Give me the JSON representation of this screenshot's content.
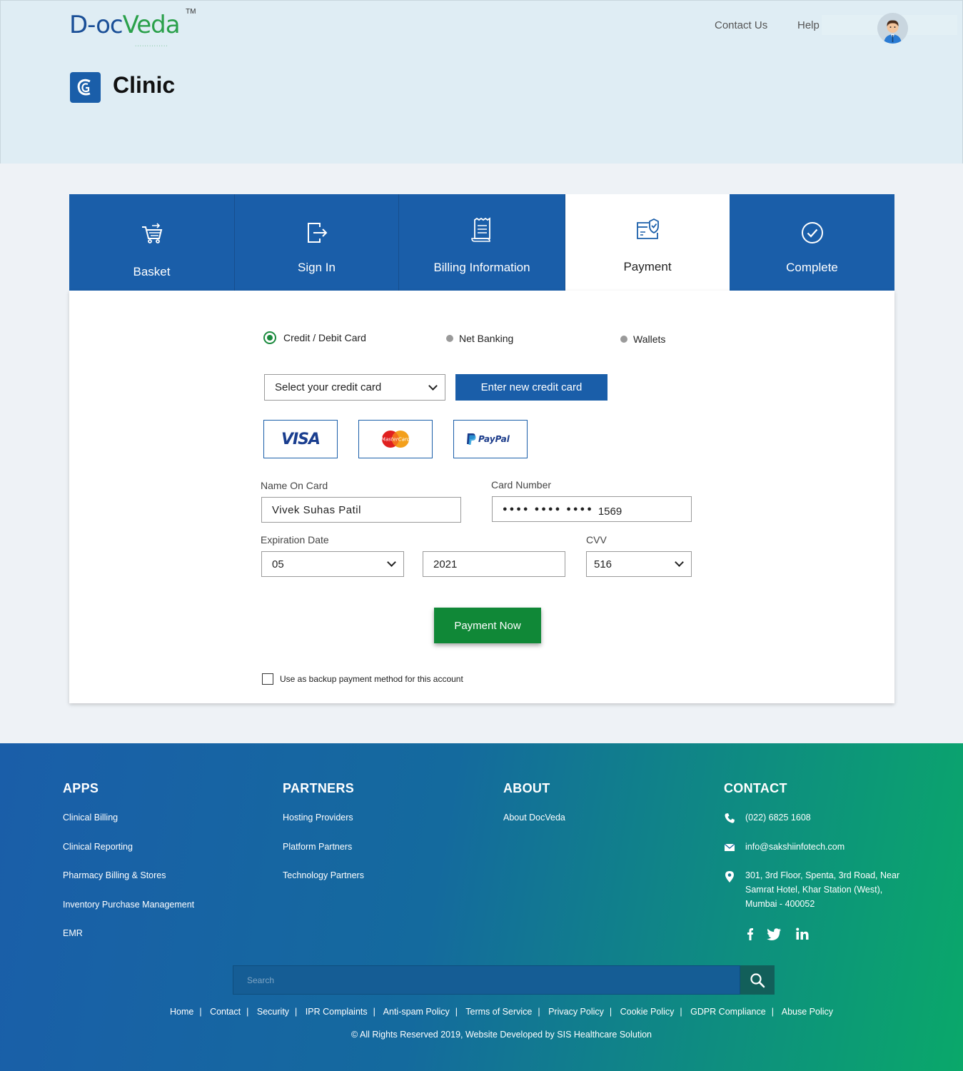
{
  "header": {
    "logo_text_1": "D-oc",
    "logo_text_2": "Veda",
    "logo_tm": "TM",
    "nav": [
      "Contact Us",
      "Help"
    ],
    "brand_title": "Clinic"
  },
  "steps": [
    {
      "label": "Basket",
      "icon": "basket-icon"
    },
    {
      "label": "Sign In",
      "icon": "sign-in-icon"
    },
    {
      "label": "Billing Information",
      "icon": "receipt-icon"
    },
    {
      "label": "Payment",
      "icon": "payment-card-icon",
      "active": true
    },
    {
      "label": "Complete",
      "icon": "check-circle-icon"
    }
  ],
  "payment": {
    "methods": [
      "Credit / Debit Card",
      "Net Banking",
      "Wallets"
    ],
    "selected_method": "Credit / Debit Card",
    "card_select": "Select your credit card",
    "new_card_button": "Enter new credit card",
    "logos": [
      "VISA",
      "MasterCard",
      "PayPal"
    ],
    "name_label": "Name On Card",
    "name_value": "Vivek Suhas Patil",
    "number_label": "Card Number",
    "number_masked": "●●●● ●●●● ●●●●",
    "number_last4": "1569",
    "expiry_label": "Expiration Date",
    "expiry_month": "05",
    "expiry_year": "2021",
    "cvv_label": "CVV",
    "cvv_value": "516",
    "pay_button": "Payment Now",
    "backup_checkbox": "Use as backup payment method for this account"
  },
  "footer": {
    "apps": {
      "heading": "APPS",
      "links": [
        "Clinical Billing",
        "Clinical Reporting",
        "Pharmacy Billing & Stores",
        "Inventory Purchase Management",
        "EMR"
      ]
    },
    "partners": {
      "heading": "PARTNERS",
      "links": [
        "Hosting Providers",
        "Platform Partners",
        "Technology Partners"
      ]
    },
    "about": {
      "heading": "ABOUT",
      "links": [
        "About DocVeda"
      ]
    },
    "contact": {
      "heading": "CONTACT",
      "phone": "(022) 6825 1608",
      "email": "info@sakshiinfotech.com",
      "address_1": "301, 3rd Floor, Spenta, 3rd Road, Near",
      "address_2": "Samrat Hotel, Khar Station (West),",
      "address_3": "Mumbai - 400052"
    },
    "search_placeholder": "Search",
    "bottom_links": [
      "Home",
      "Contact",
      "Security",
      "IPR Complaints",
      "Anti-spam Policy",
      "Terms of Service",
      "Privacy Policy",
      "Cookie Policy",
      "GDPR Compliance",
      "Abuse Policy"
    ],
    "copyright": "© All Rights Reserved 2019, Website Developed by SIS Healthcare Solution"
  },
  "colors": {
    "primary": "#1a5ea9",
    "green": "#108837",
    "header_bg": "#dfedf4"
  }
}
